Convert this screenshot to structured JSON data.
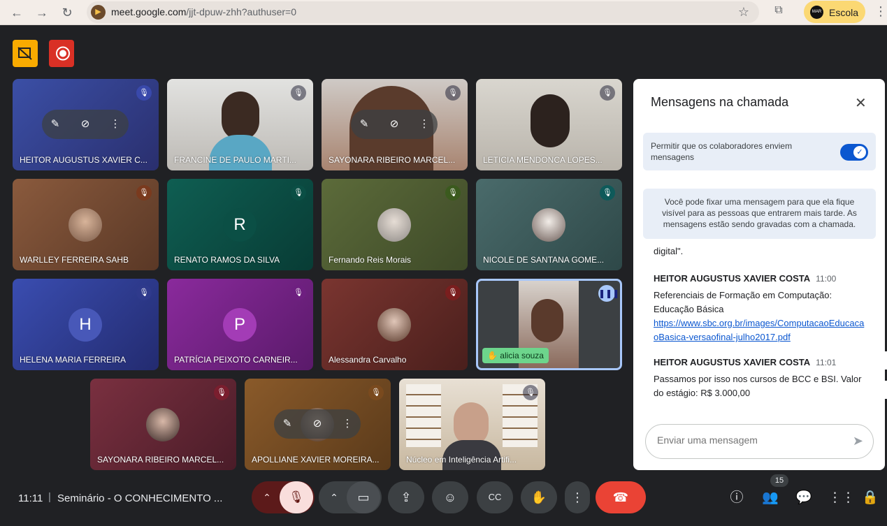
{
  "browser": {
    "url_host": "meet.google.com",
    "url_path": "/jjt-dpuw-zhh?authuser=0",
    "profile_name": "Escola",
    "profile_avatar_text": "MAR"
  },
  "tiles": [
    {
      "name": "HEITOR AUGUSTUS XAVIER C...",
      "type": "video"
    },
    {
      "name": "FRANCINE DE PAULO MARTI...",
      "type": "video"
    },
    {
      "name": "SAYONARA RIBEIRO MARCEL...",
      "type": "video"
    },
    {
      "name": "LETICIA MENDONCA LOPES...",
      "type": "video"
    },
    {
      "name": "WARLLEY FERREIRA SAHB",
      "type": "photo"
    },
    {
      "name": "RENATO RAMOS DA SILVA",
      "type": "initial",
      "initial": "R"
    },
    {
      "name": "Fernando Reis Morais",
      "type": "photo"
    },
    {
      "name": "NICOLE DE SANTANA GOME...",
      "type": "photo"
    },
    {
      "name": "HELENA MARIA FERREIRA",
      "type": "initial",
      "initial": "H"
    },
    {
      "name": "PATRÍCIA PEIXOTO CARNEIR...",
      "type": "initial",
      "initial": "P"
    },
    {
      "name": "Alessandra Carvalho",
      "type": "photo"
    },
    {
      "name": "alicia souza",
      "type": "video"
    },
    {
      "name": "SAYONARA RIBEIRO MARCEL...",
      "type": "photo"
    },
    {
      "name": "APOLLIANE XAVIER MOREIRA...",
      "type": "photo"
    },
    {
      "name": "Núcleo em Inteligência Artifi...",
      "type": "video"
    }
  ],
  "chat": {
    "title": "Mensagens na chamada",
    "permission_text": "Permitir que os colaboradores enviem mensagens",
    "pin_note": "Você pode fixar uma mensagem para que ela fique visível para as pessoas que entrarem mais tarde. As mensagens estão sendo gravadas com a chamada.",
    "fragment": "digital\".",
    "messages": [
      {
        "author": "HEITOR AUGUSTUS XAVIER COSTA",
        "time": "11:00",
        "body": "Referenciais de Formação em Computação: Educação Básica",
        "link": "https://www.sbc.org.br/images/ComputacaoEducacaoBasica-versaofinal-julho2017.pdf"
      },
      {
        "author": "HEITOR AUGUSTUS XAVIER COSTA",
        "time": "11:01",
        "body": "Passamos por isso nos cursos de BCC e BSI. Valor do estágio: R$ 3.000,00"
      }
    ],
    "input_placeholder": "Enviar uma mensagem"
  },
  "bottom_bar": {
    "time": "11:11",
    "separator": "|",
    "meeting_title": "Seminário - O CONHECIMENTO ...",
    "participants_count": "15"
  },
  "colors": {
    "end_call": "#ea4335",
    "mic_off": "#f9dedc",
    "accent_blue": "#0b57d0",
    "record": "#d93025",
    "warning_yellow": "#f9ab00"
  }
}
